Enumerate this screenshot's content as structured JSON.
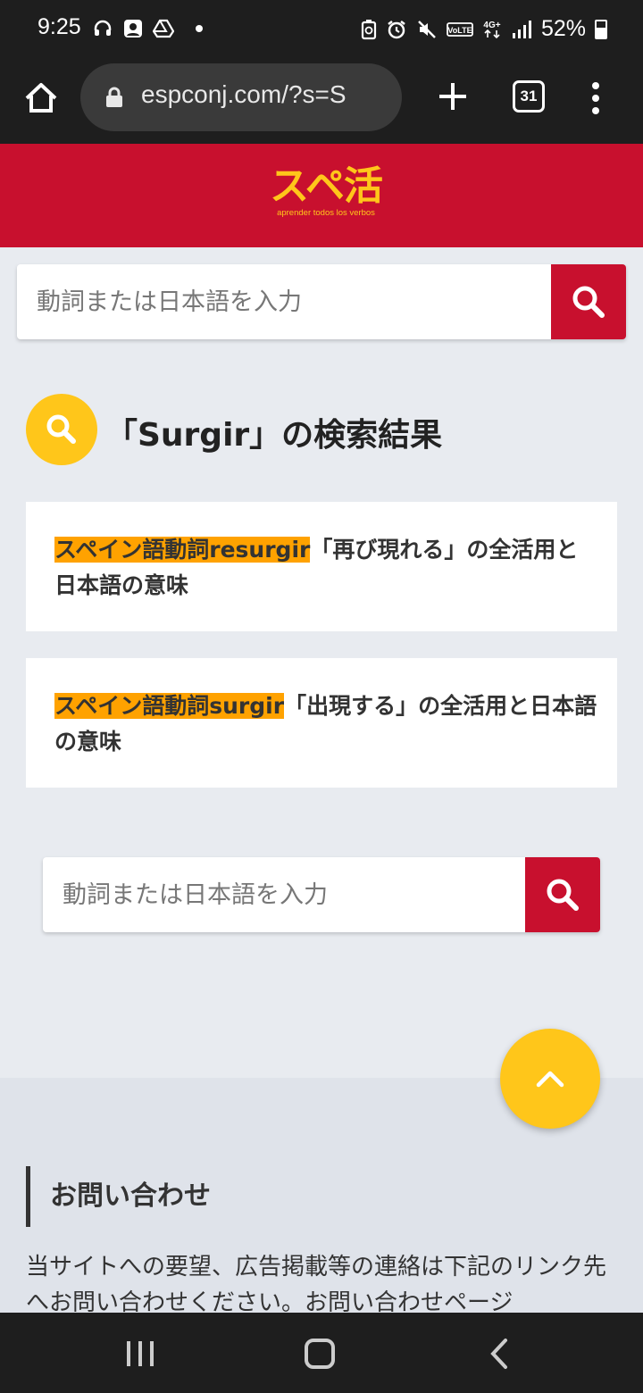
{
  "status_bar": {
    "time": "9:25",
    "left_icons": [
      "headset-icon",
      "contact-card-icon",
      "drive-icon"
    ],
    "right_icons": [
      "battery-saver-icon",
      "alarm-icon",
      "mute-icon",
      "volte-icon",
      "4g-icon",
      "signal-icon"
    ],
    "battery": "52%"
  },
  "browser": {
    "url": "espconj.com/?s=S",
    "tab_count": "31"
  },
  "site": {
    "logo_main": "スペ活",
    "logo_sub": "aprender todos los verbos",
    "brand_red": "#c8102e",
    "brand_yellow": "#ffc61a",
    "highlight": "#ffa200"
  },
  "search_top": {
    "placeholder": "動詞または日本語を入力"
  },
  "results": {
    "title": "「Surgir」の検索結果",
    "items": [
      {
        "highlight": "スペイン語動詞resurgir",
        "text": "「再び現れる」の全活用と日本語の意味"
      },
      {
        "highlight": "スペイン語動詞surgir",
        "text": "「出現する」の全活用と日本語の意味"
      }
    ]
  },
  "search_bottom": {
    "placeholder": "動詞または日本語を入力"
  },
  "footer": {
    "contact_heading": "お問い合わせ",
    "contact_text": "当サイトへの要望、広告掲載等の連絡は下記のリンク先へお問い合わせください。お問い合わせページ"
  }
}
